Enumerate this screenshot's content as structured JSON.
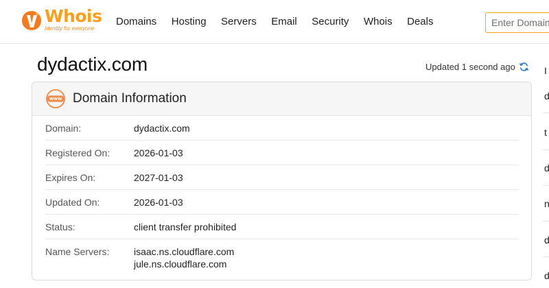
{
  "header": {
    "logo_word": "Whois",
    "logo_tagline": "Identity for everyone",
    "nav": [
      "Domains",
      "Hosting",
      "Servers",
      "Email",
      "Security",
      "Whois",
      "Deals"
    ],
    "search_placeholder": "Enter Domain",
    "brand_color": "#f8a01c"
  },
  "page": {
    "title": "dydactix.com",
    "updated_text": "Updated 1 second ago"
  },
  "card": {
    "title": "Domain Information",
    "rows": [
      {
        "label": "Domain:",
        "value": "dydactix.com"
      },
      {
        "label": "Registered On:",
        "value": "2026-01-03"
      },
      {
        "label": "Expires On:",
        "value": "2027-01-03"
      },
      {
        "label": "Updated On:",
        "value": "2026-01-03"
      },
      {
        "label": "Status:",
        "value": "client transfer prohibited"
      },
      {
        "label": "Name Servers:",
        "values": [
          "isaac.ns.cloudflare.com",
          "jule.ns.cloudflare.com"
        ]
      }
    ]
  },
  "side_column": {
    "letters": [
      "I",
      "d",
      "t",
      "d",
      "n",
      "d",
      "d"
    ]
  }
}
